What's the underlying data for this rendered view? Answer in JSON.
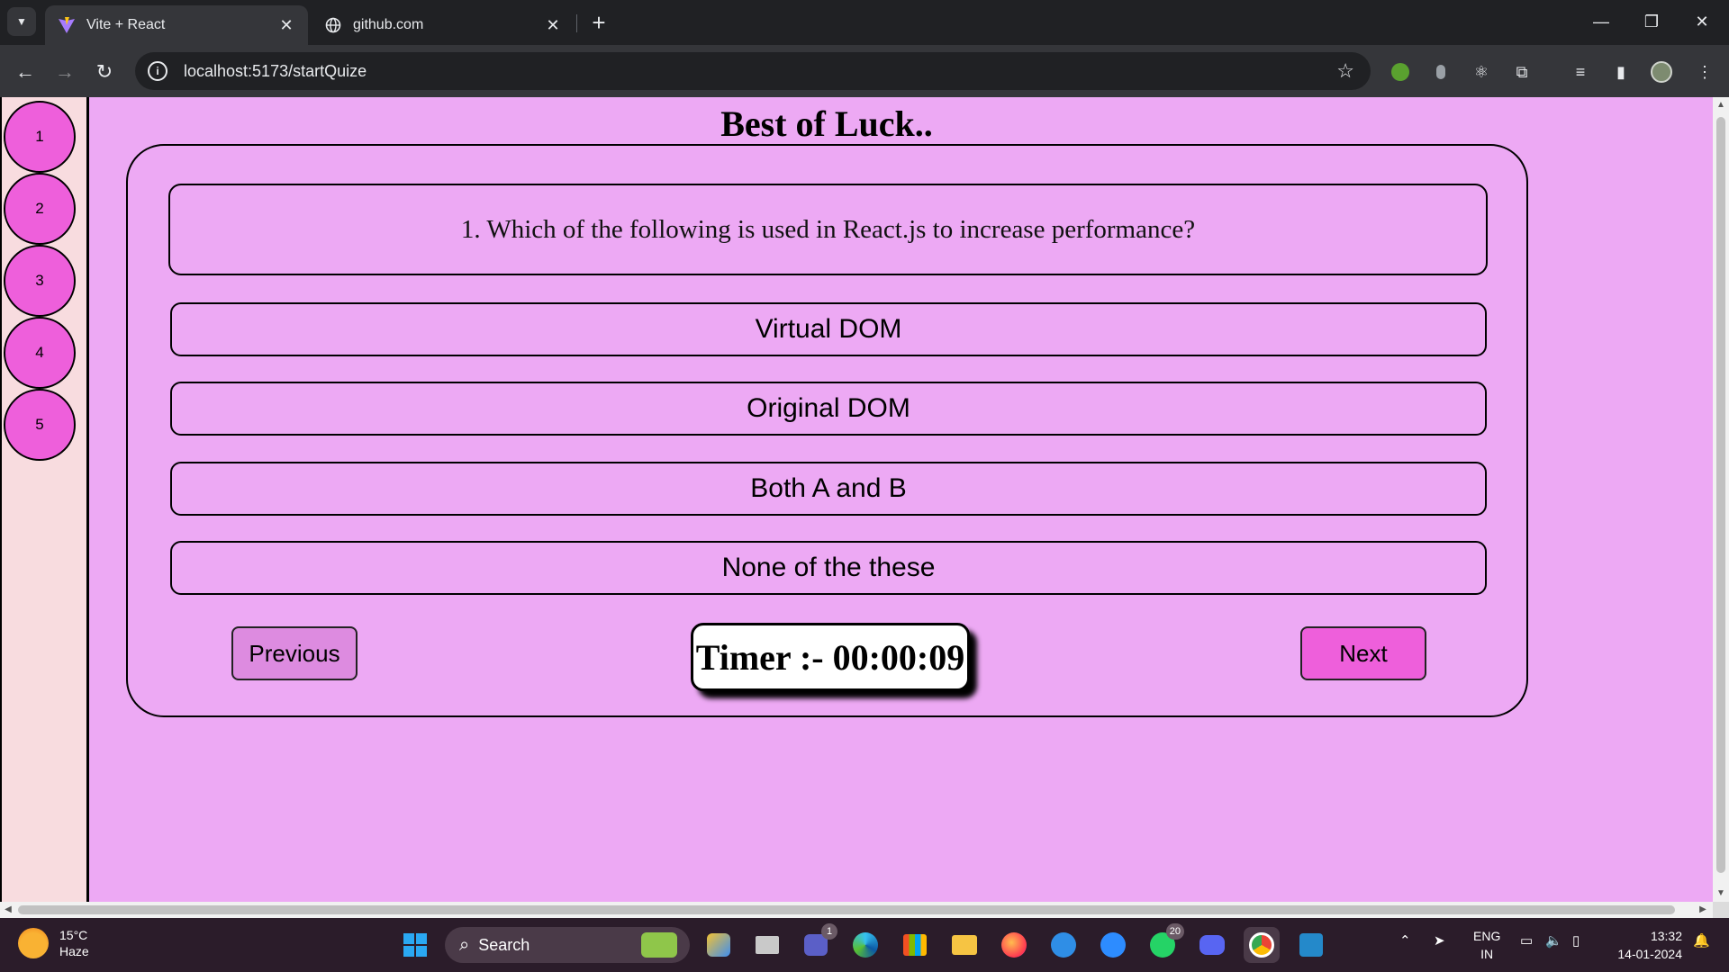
{
  "browser": {
    "tabs": [
      {
        "title": "Vite + React",
        "active": true
      },
      {
        "title": "github.com",
        "active": false
      }
    ],
    "url": "localhost:5173/startQuize"
  },
  "sidebar": {
    "question_numbers": [
      "1",
      "2",
      "3",
      "4",
      "5"
    ]
  },
  "quiz": {
    "heading": "Best of Luck..",
    "question": "1. Which of the following is used in React.js to increase performance?",
    "options": [
      "Virtual DOM",
      "Original DOM",
      "Both A and B",
      "None of the these"
    ],
    "previous_label": "Previous",
    "next_label": "Next",
    "timer": "Timer :- 00:00:09"
  },
  "taskbar": {
    "weather_temp": "15°C",
    "weather_desc": "Haze",
    "search_label": "Search",
    "teams_badge": "1",
    "whatsapp_badge": "20",
    "lang_line1": "ENG",
    "lang_line2": "IN",
    "time": "13:32",
    "date": "14-01-2024"
  },
  "colors": {
    "page_bg": "#eda9f4",
    "sidebar_bg": "#f8dcdf",
    "circle_fill": "#ee5fdb",
    "prev_button": "#dd8be0",
    "next_button": "#ee5fdb"
  }
}
